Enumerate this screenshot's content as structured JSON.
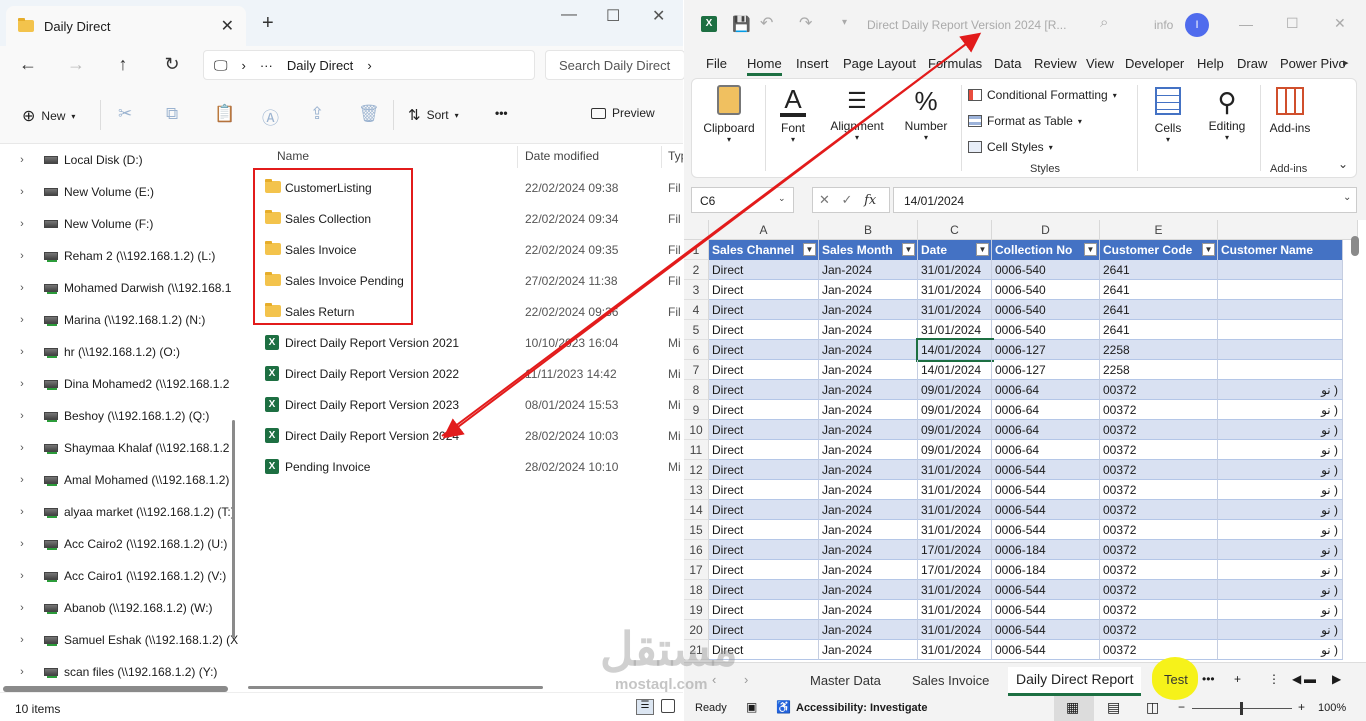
{
  "explorer": {
    "tab_title": "Daily Direct",
    "new_tab": "+",
    "address": {
      "path_item": "Daily Direct",
      "ellipsis": "···"
    },
    "search_placeholder": "Search Daily Direct",
    "toolbar": {
      "new_label": "New",
      "sort_label": "Sort",
      "more": "•••",
      "preview_label": "Preview"
    },
    "sidebar": [
      {
        "label": "Local Disk (D:)",
        "net": false
      },
      {
        "label": "New Volume (E:)",
        "net": false
      },
      {
        "label": "New Volume (F:)",
        "net": false
      },
      {
        "label": "Reham 2 (\\\\192.168.1.2) (L:)",
        "net": true
      },
      {
        "label": "Mohamed Darwish (\\\\192.168.1",
        "net": true
      },
      {
        "label": "Marina (\\\\192.168.1.2) (N:)",
        "net": true
      },
      {
        "label": "hr (\\\\192.168.1.2) (O:)",
        "net": true
      },
      {
        "label": "Dina Mohamed2 (\\\\192.168.1.2",
        "net": true
      },
      {
        "label": "Beshoy (\\\\192.168.1.2) (Q:)",
        "net": true
      },
      {
        "label": "Shaymaa Khalaf (\\\\192.168.1.2",
        "net": true
      },
      {
        "label": "Amal Mohamed (\\\\192.168.1.2)",
        "net": true
      },
      {
        "label": "alyaa market (\\\\192.168.1.2) (T:)",
        "net": true
      },
      {
        "label": "Acc Cairo2 (\\\\192.168.1.2) (U:)",
        "net": true
      },
      {
        "label": "Acc Cairo1 (\\\\192.168.1.2) (V:)",
        "net": true
      },
      {
        "label": "Abanob (\\\\192.168.1.2) (W:)",
        "net": true
      },
      {
        "label": "Samuel Eshak (\\\\192.168.1.2) (X",
        "net": true
      },
      {
        "label": "scan files (\\\\192.168.1.2) (Y:)",
        "net": true
      }
    ],
    "columns": {
      "name": "Name",
      "date": "Date modified",
      "type": "Typ"
    },
    "files": [
      {
        "name": "CustomerListing",
        "date": "22/02/2024 09:38",
        "type": "Fil",
        "kind": "folder"
      },
      {
        "name": "Sales Collection",
        "date": "22/02/2024 09:34",
        "type": "Fil",
        "kind": "folder"
      },
      {
        "name": "Sales Invoice",
        "date": "22/02/2024 09:35",
        "type": "Fil",
        "kind": "folder"
      },
      {
        "name": "Sales Invoice Pending",
        "date": "27/02/2024 11:38",
        "type": "Fil",
        "kind": "folder"
      },
      {
        "name": "Sales Return",
        "date": "22/02/2024 09:36",
        "type": "Fil",
        "kind": "folder"
      },
      {
        "name": "Direct Daily Report Version 2021",
        "date": "10/10/2023 16:04",
        "type": "Mi",
        "kind": "xls"
      },
      {
        "name": "Direct Daily Report Version 2022",
        "date": "11/11/2023 14:42",
        "type": "Mi",
        "kind": "xls"
      },
      {
        "name": "Direct Daily Report Version 2023",
        "date": "08/01/2024 15:53",
        "type": "Mi",
        "kind": "xls"
      },
      {
        "name": "Direct Daily Report Version 2024",
        "date": "28/02/2024 10:03",
        "type": "Mi",
        "kind": "xls"
      },
      {
        "name": "Pending Invoice",
        "date": "28/02/2024 10:10",
        "type": "Mi",
        "kind": "xls"
      }
    ],
    "status": "10 items"
  },
  "excel": {
    "title": "Direct Daily Report Version 2024  [R...",
    "user": "info",
    "avatar_initial": "I",
    "tabs": [
      "File",
      "Home",
      "Insert",
      "Page Layout",
      "Formulas",
      "Data",
      "Review",
      "View",
      "Developer",
      "Help",
      "Draw",
      "Power Pivo"
    ],
    "active_tab": "Home",
    "ribbon": {
      "clipboard": "Clipboard",
      "font": "Font",
      "alignment": "Alignment",
      "number": "Number",
      "conditional_formatting": "Conditional Formatting",
      "format_as_table": "Format as Table",
      "cell_styles": "Cell Styles",
      "styles_group": "Styles",
      "cells": "Cells",
      "editing": "Editing",
      "addins": "Add-ins",
      "addins_group": "Add-ins"
    },
    "name_box": "C6",
    "formula_value": "14/01/2024",
    "fx_label": "fx",
    "col_letters": [
      "A",
      "B",
      "C",
      "D",
      "E"
    ],
    "headers": [
      "Sales Channel",
      "Sales Month",
      "Date",
      "Collection No",
      "Customer Code",
      "Customer Name"
    ],
    "rows": [
      [
        "2",
        "Direct",
        "Jan-2024",
        "31/01/2024",
        "0006-540",
        "2641",
        ""
      ],
      [
        "3",
        "Direct",
        "Jan-2024",
        "31/01/2024",
        "0006-540",
        "2641",
        ""
      ],
      [
        "4",
        "Direct",
        "Jan-2024",
        "31/01/2024",
        "0006-540",
        "2641",
        ""
      ],
      [
        "5",
        "Direct",
        "Jan-2024",
        "31/01/2024",
        "0006-540",
        "2641",
        ""
      ],
      [
        "6",
        "Direct",
        "Jan-2024",
        "14/01/2024",
        "0006-127",
        "2258",
        ""
      ],
      [
        "7",
        "Direct",
        "Jan-2024",
        "14/01/2024",
        "0006-127",
        "2258",
        ""
      ],
      [
        "8",
        "Direct",
        "Jan-2024",
        "09/01/2024",
        "0006-64",
        "00372",
        "نو )"
      ],
      [
        "9",
        "Direct",
        "Jan-2024",
        "09/01/2024",
        "0006-64",
        "00372",
        "نو )"
      ],
      [
        "10",
        "Direct",
        "Jan-2024",
        "09/01/2024",
        "0006-64",
        "00372",
        "نو )"
      ],
      [
        "11",
        "Direct",
        "Jan-2024",
        "09/01/2024",
        "0006-64",
        "00372",
        "نو )"
      ],
      [
        "12",
        "Direct",
        "Jan-2024",
        "31/01/2024",
        "0006-544",
        "00372",
        "نو )"
      ],
      [
        "13",
        "Direct",
        "Jan-2024",
        "31/01/2024",
        "0006-544",
        "00372",
        "نو )"
      ],
      [
        "14",
        "Direct",
        "Jan-2024",
        "31/01/2024",
        "0006-544",
        "00372",
        "نو )"
      ],
      [
        "15",
        "Direct",
        "Jan-2024",
        "31/01/2024",
        "0006-544",
        "00372",
        "نو )"
      ],
      [
        "16",
        "Direct",
        "Jan-2024",
        "17/01/2024",
        "0006-184",
        "00372",
        "نو )"
      ],
      [
        "17",
        "Direct",
        "Jan-2024",
        "17/01/2024",
        "0006-184",
        "00372",
        "نو )"
      ],
      [
        "18",
        "Direct",
        "Jan-2024",
        "31/01/2024",
        "0006-544",
        "00372",
        "نو )"
      ],
      [
        "19",
        "Direct",
        "Jan-2024",
        "31/01/2024",
        "0006-544",
        "00372",
        "نو )"
      ],
      [
        "20",
        "Direct",
        "Jan-2024",
        "31/01/2024",
        "0006-544",
        "00372",
        "نو )"
      ],
      [
        "21",
        "Direct",
        "Jan-2024",
        "31/01/2024",
        "0006-544",
        "00372",
        "نو )"
      ]
    ],
    "sheets": [
      "Master Data",
      "Sales Invoice",
      "Daily Direct Report",
      "Test"
    ],
    "active_sheet": "Daily Direct Report",
    "status": {
      "ready": "Ready",
      "accessibility": "Accessibility: Investigate",
      "zoom": "100%"
    }
  },
  "watermark": {
    "arabic": "مستقل",
    "latin": "mostaql.com"
  },
  "colors": {
    "accent_red": "#e21b1b",
    "table_header": "#4472c4",
    "band": "#d9e1f2",
    "highlight_yellow": "#f6f21a",
    "excel_green": "#1d6f42"
  }
}
